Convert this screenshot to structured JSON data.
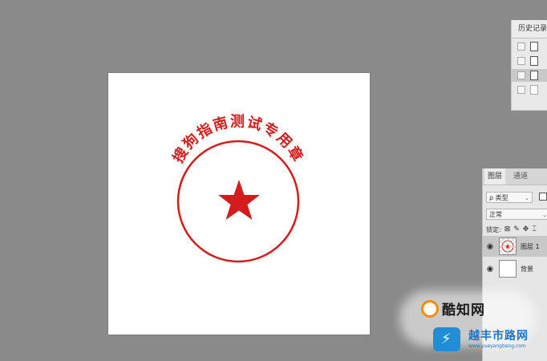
{
  "history_panel": {
    "tab_label": "历史记录",
    "rows": [
      {
        "state": "normal"
      },
      {
        "state": "normal"
      },
      {
        "state": "selected"
      },
      {
        "state": "dim"
      }
    ]
  },
  "layers_panel": {
    "tabs": [
      "图层",
      "通道"
    ],
    "filter": {
      "label": "ρ 类型",
      "chevron": "⌄"
    },
    "blend_mode": {
      "label": "正常",
      "chevron": "⌄"
    },
    "lock_label": "锁定:",
    "layers": [
      {
        "name": "图层 1",
        "visible": true,
        "selected": true
      },
      {
        "name": "背景",
        "visible": true,
        "selected": false
      }
    ]
  },
  "stamp": {
    "text": "搜狗指南测试专用章",
    "color": "#d41c1c",
    "star": true
  },
  "watermarks": {
    "primary": "酷知网",
    "secondary_title": "越丰市路网",
    "secondary_url": "www.yueyangbang.com"
  },
  "colors": {
    "workspace": "#8a8a8a",
    "canvas": "#ffffff",
    "stamp_red": "#d41c1c"
  }
}
